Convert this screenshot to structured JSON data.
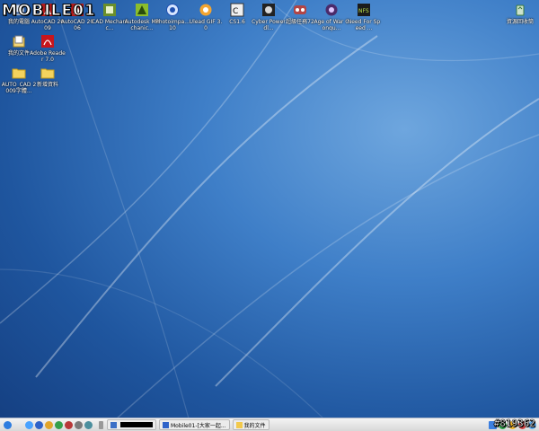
{
  "watermark_logo": "MOBILE01",
  "watermark_id": "#819362",
  "desktop_icons": [
    {
      "label": "我的電腦",
      "icon": "computer-icon"
    },
    {
      "label": "AutoCAD 2009",
      "icon": "autocad-icon"
    },
    {
      "label": "AutoCAD 2006",
      "icon": "autocad-icon"
    },
    {
      "label": "CAD Mechanic...",
      "icon": "autocad-mechanical-icon"
    },
    {
      "label": "Autodesk Mechanic...",
      "icon": "autodesk-icon"
    },
    {
      "label": "Photoimpa... 10",
      "icon": "photoimpact-icon"
    },
    {
      "label": "Ulead GIF 3.0",
      "icon": "ulead-gif-icon"
    },
    {
      "label": "CS1.6",
      "icon": "counter-strike-icon"
    },
    {
      "label": "Cyber Powerdl...",
      "icon": "cyberpower-icon"
    },
    {
      "label": "超級任務72",
      "icon": "game-icon"
    },
    {
      "label": "Age of War Conqu...",
      "icon": "age-of-war-icon"
    },
    {
      "label": "Need For Speed ...",
      "icon": "need-for-speed-icon"
    },
    {
      "label": "資源回收筒",
      "icon": "recycle-bin-icon"
    },
    {
      "label": "我的文件",
      "icon": "my-documents-icon"
    },
    {
      "label": "Adobe Reader 7.0",
      "icon": "adobe-reader-icon"
    },
    {
      "label": "AUTO_CAD 2009字體...",
      "icon": "folder-icon"
    },
    {
      "label": "新增資料",
      "icon": "folder-icon"
    }
  ],
  "taskbar": {
    "tasks": [
      {
        "label": "Mobile01-[大家一起...",
        "icon": "ie-window-icon"
      },
      {
        "label": "我的文件",
        "icon": "folder-window-icon"
      }
    ]
  }
}
